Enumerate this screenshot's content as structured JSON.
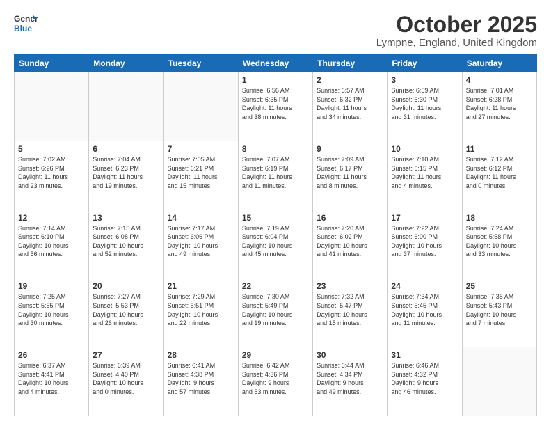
{
  "logo": {
    "general": "General",
    "blue": "Blue"
  },
  "title": "October 2025",
  "subtitle": "Lympne, England, United Kingdom",
  "days_of_week": [
    "Sunday",
    "Monday",
    "Tuesday",
    "Wednesday",
    "Thursday",
    "Friday",
    "Saturday"
  ],
  "weeks": [
    [
      {
        "day": "",
        "info": ""
      },
      {
        "day": "",
        "info": ""
      },
      {
        "day": "",
        "info": ""
      },
      {
        "day": "1",
        "info": "Sunrise: 6:56 AM\nSunset: 6:35 PM\nDaylight: 11 hours\nand 38 minutes."
      },
      {
        "day": "2",
        "info": "Sunrise: 6:57 AM\nSunset: 6:32 PM\nDaylight: 11 hours\nand 34 minutes."
      },
      {
        "day": "3",
        "info": "Sunrise: 6:59 AM\nSunset: 6:30 PM\nDaylight: 11 hours\nand 31 minutes."
      },
      {
        "day": "4",
        "info": "Sunrise: 7:01 AM\nSunset: 6:28 PM\nDaylight: 11 hours\nand 27 minutes."
      }
    ],
    [
      {
        "day": "5",
        "info": "Sunrise: 7:02 AM\nSunset: 6:26 PM\nDaylight: 11 hours\nand 23 minutes."
      },
      {
        "day": "6",
        "info": "Sunrise: 7:04 AM\nSunset: 6:23 PM\nDaylight: 11 hours\nand 19 minutes."
      },
      {
        "day": "7",
        "info": "Sunrise: 7:05 AM\nSunset: 6:21 PM\nDaylight: 11 hours\nand 15 minutes."
      },
      {
        "day": "8",
        "info": "Sunrise: 7:07 AM\nSunset: 6:19 PM\nDaylight: 11 hours\nand 11 minutes."
      },
      {
        "day": "9",
        "info": "Sunrise: 7:09 AM\nSunset: 6:17 PM\nDaylight: 11 hours\nand 8 minutes."
      },
      {
        "day": "10",
        "info": "Sunrise: 7:10 AM\nSunset: 6:15 PM\nDaylight: 11 hours\nand 4 minutes."
      },
      {
        "day": "11",
        "info": "Sunrise: 7:12 AM\nSunset: 6:12 PM\nDaylight: 11 hours\nand 0 minutes."
      }
    ],
    [
      {
        "day": "12",
        "info": "Sunrise: 7:14 AM\nSunset: 6:10 PM\nDaylight: 10 hours\nand 56 minutes."
      },
      {
        "day": "13",
        "info": "Sunrise: 7:15 AM\nSunset: 6:08 PM\nDaylight: 10 hours\nand 52 minutes."
      },
      {
        "day": "14",
        "info": "Sunrise: 7:17 AM\nSunset: 6:06 PM\nDaylight: 10 hours\nand 49 minutes."
      },
      {
        "day": "15",
        "info": "Sunrise: 7:19 AM\nSunset: 6:04 PM\nDaylight: 10 hours\nand 45 minutes."
      },
      {
        "day": "16",
        "info": "Sunrise: 7:20 AM\nSunset: 6:02 PM\nDaylight: 10 hours\nand 41 minutes."
      },
      {
        "day": "17",
        "info": "Sunrise: 7:22 AM\nSunset: 6:00 PM\nDaylight: 10 hours\nand 37 minutes."
      },
      {
        "day": "18",
        "info": "Sunrise: 7:24 AM\nSunset: 5:58 PM\nDaylight: 10 hours\nand 33 minutes."
      }
    ],
    [
      {
        "day": "19",
        "info": "Sunrise: 7:25 AM\nSunset: 5:55 PM\nDaylight: 10 hours\nand 30 minutes."
      },
      {
        "day": "20",
        "info": "Sunrise: 7:27 AM\nSunset: 5:53 PM\nDaylight: 10 hours\nand 26 minutes."
      },
      {
        "day": "21",
        "info": "Sunrise: 7:29 AM\nSunset: 5:51 PM\nDaylight: 10 hours\nand 22 minutes."
      },
      {
        "day": "22",
        "info": "Sunrise: 7:30 AM\nSunset: 5:49 PM\nDaylight: 10 hours\nand 19 minutes."
      },
      {
        "day": "23",
        "info": "Sunrise: 7:32 AM\nSunset: 5:47 PM\nDaylight: 10 hours\nand 15 minutes."
      },
      {
        "day": "24",
        "info": "Sunrise: 7:34 AM\nSunset: 5:45 PM\nDaylight: 10 hours\nand 11 minutes."
      },
      {
        "day": "25",
        "info": "Sunrise: 7:35 AM\nSunset: 5:43 PM\nDaylight: 10 hours\nand 7 minutes."
      }
    ],
    [
      {
        "day": "26",
        "info": "Sunrise: 6:37 AM\nSunset: 4:41 PM\nDaylight: 10 hours\nand 4 minutes."
      },
      {
        "day": "27",
        "info": "Sunrise: 6:39 AM\nSunset: 4:40 PM\nDaylight: 10 hours\nand 0 minutes."
      },
      {
        "day": "28",
        "info": "Sunrise: 6:41 AM\nSunset: 4:38 PM\nDaylight: 9 hours\nand 57 minutes."
      },
      {
        "day": "29",
        "info": "Sunrise: 6:42 AM\nSunset: 4:36 PM\nDaylight: 9 hours\nand 53 minutes."
      },
      {
        "day": "30",
        "info": "Sunrise: 6:44 AM\nSunset: 4:34 PM\nDaylight: 9 hours\nand 49 minutes."
      },
      {
        "day": "31",
        "info": "Sunrise: 6:46 AM\nSunset: 4:32 PM\nDaylight: 9 hours\nand 46 minutes."
      },
      {
        "day": "",
        "info": ""
      }
    ]
  ]
}
